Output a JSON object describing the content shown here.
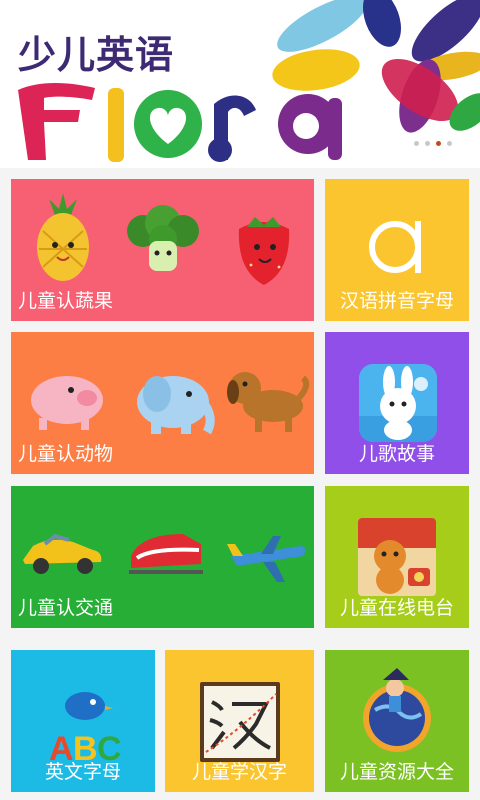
{
  "banner": {
    "title_cn": "少儿英语",
    "logo_text": "Flora",
    "carousel_dots": 4,
    "carousel_active_index": 2
  },
  "tiles": [
    {
      "label": "儿童认蔬果",
      "color": "#f76073",
      "icon": "fruit-vegetable-illustration"
    },
    {
      "label": "汉语拼音字母",
      "color": "#fbc530",
      "icon": "letter-a-icon"
    },
    {
      "label": "儿童认动物",
      "color": "#fc7e45",
      "icon": "animals-illustration"
    },
    {
      "label": "儿歌故事",
      "color": "#8f4fe8",
      "icon": "bunny-app-icon"
    },
    {
      "label": "儿童认交通",
      "color": "#27ae36",
      "icon": "vehicles-illustration"
    },
    {
      "label": "儿童在线电台",
      "color": "#a6cd1a",
      "icon": "beaver-radio-icon"
    },
    {
      "label": "英文字母",
      "color": "#1cbbe6",
      "icon": "abc-bird-icon"
    },
    {
      "label": "儿童学汉字",
      "color": "#fbc530",
      "icon": "hanzi-book-icon"
    },
    {
      "label": "儿童资源大全",
      "color": "#7bc123",
      "icon": "globe-explorer-icon"
    }
  ]
}
